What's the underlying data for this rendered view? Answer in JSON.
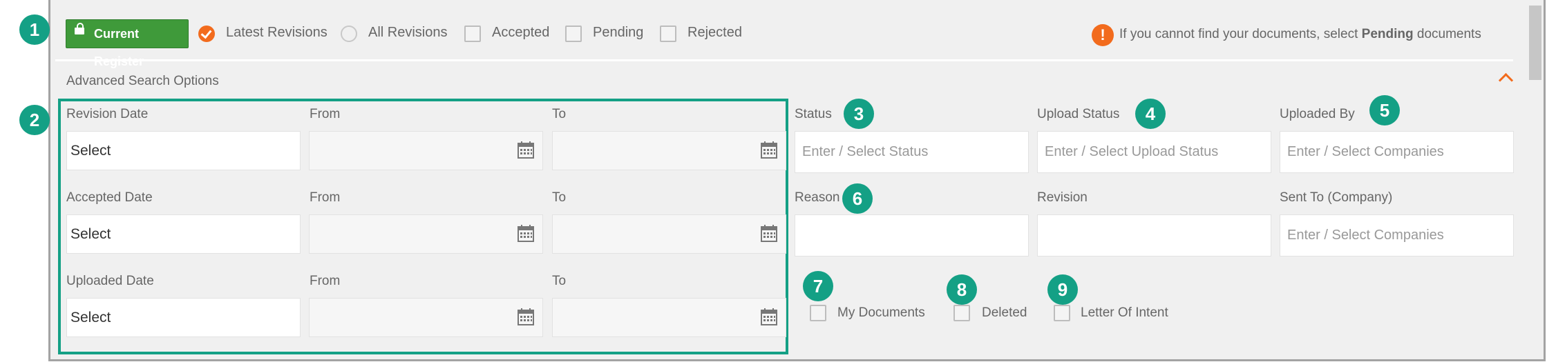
{
  "callouts": [
    "1",
    "2",
    "3",
    "4",
    "5",
    "6",
    "7",
    "8",
    "9"
  ],
  "toolbar": {
    "register_button": "Current Register",
    "options": [
      {
        "label": "Latest Revisions",
        "type": "radio",
        "selected": true
      },
      {
        "label": "All Revisions",
        "type": "radio",
        "selected": false
      },
      {
        "label": "Accepted",
        "type": "checkbox",
        "checked": false
      },
      {
        "label": "Pending",
        "type": "checkbox",
        "checked": false
      },
      {
        "label": "Rejected",
        "type": "checkbox",
        "checked": false
      }
    ],
    "notice_icon": "!",
    "notice_prefix": "If you cannot find your documents, select ",
    "notice_bold": "Pending",
    "notice_suffix": " documents"
  },
  "advanced": {
    "title": "Advanced Search Options",
    "date_rows": [
      {
        "label": "Revision Date",
        "value": "Select",
        "from_label": "From",
        "to_label": "To"
      },
      {
        "label": "Accepted Date",
        "value": "Select",
        "from_label": "From",
        "to_label": "To"
      },
      {
        "label": "Uploaded Date",
        "value": "Select",
        "from_label": "From",
        "to_label": "To"
      }
    ],
    "status": {
      "label": "Status",
      "placeholder": "Enter / Select Status"
    },
    "upload_status": {
      "label": "Upload Status",
      "placeholder": "Enter / Select Upload Status"
    },
    "uploaded_by": {
      "label": "Uploaded By",
      "placeholder": "Enter / Select Companies"
    },
    "reason": {
      "label": "Reason",
      "value": ""
    },
    "revision": {
      "label": "Revision",
      "value": ""
    },
    "sent_to": {
      "label": "Sent To (Company)",
      "placeholder": "Enter / Select Companies"
    },
    "checkboxes": [
      {
        "label": "My Documents",
        "checked": false
      },
      {
        "label": "Deleted",
        "checked": false
      },
      {
        "label": "Letter Of Intent",
        "checked": false
      }
    ]
  },
  "colors": {
    "accent": "#f26b1d",
    "callout": "#14a085",
    "register_green": "#3f9a3a"
  }
}
